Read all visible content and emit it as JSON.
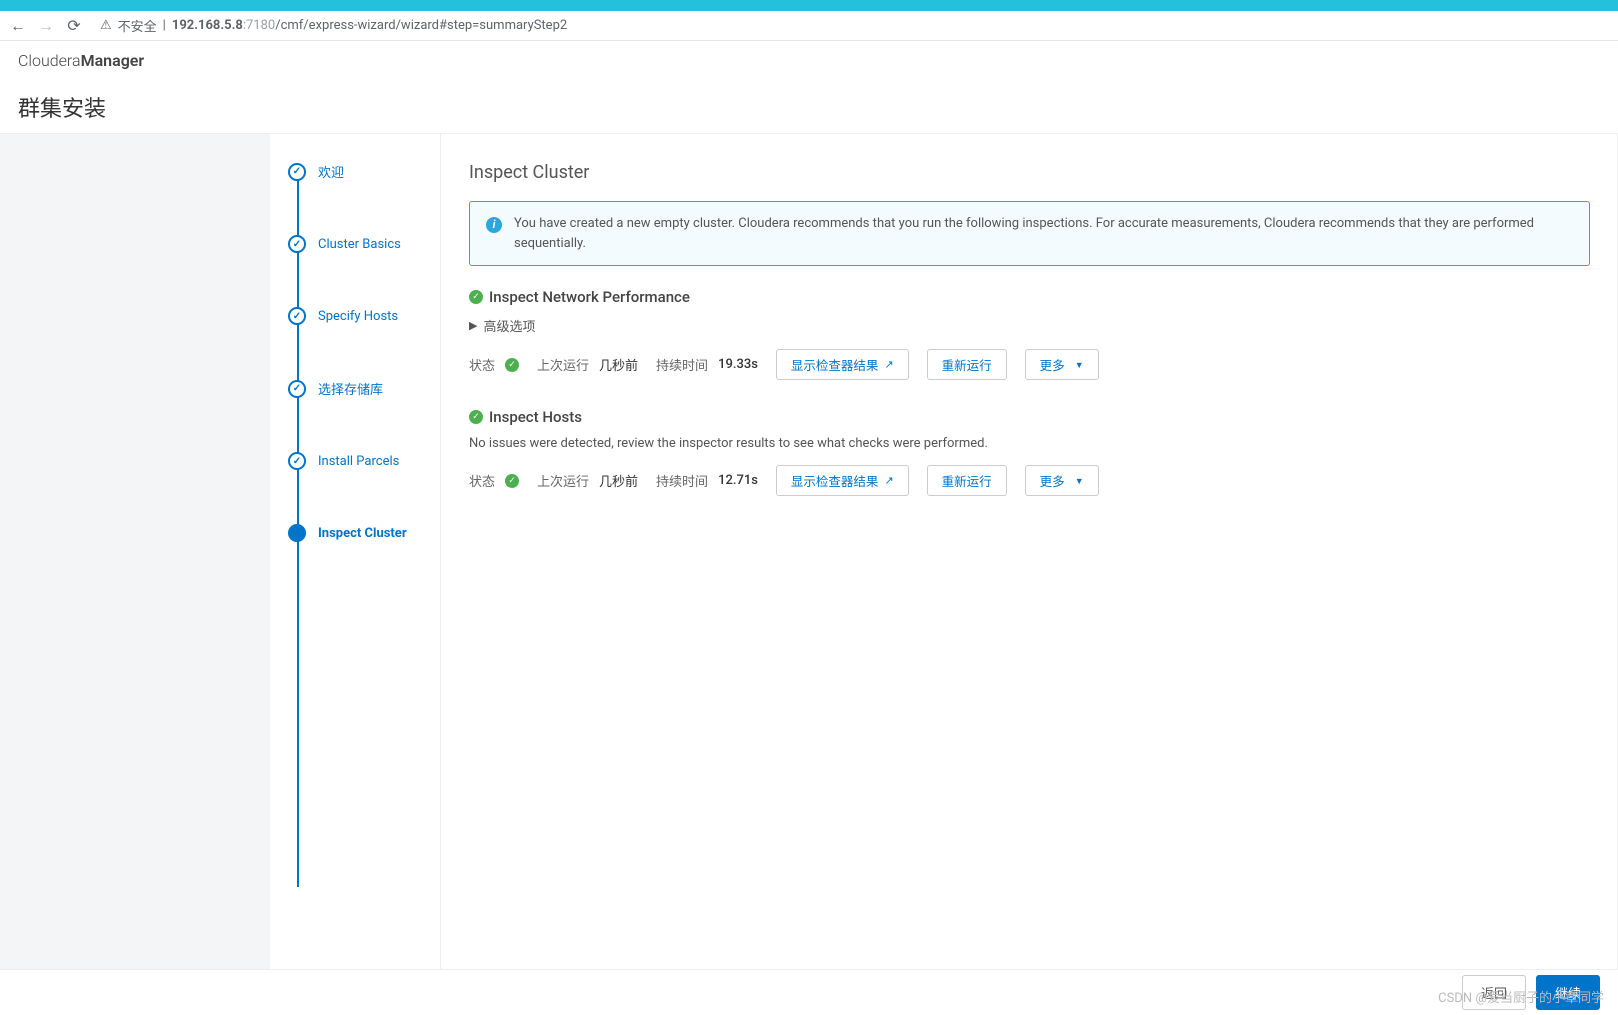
{
  "browser": {
    "insecure_label": "不安全",
    "url_host": "192.168.5.8",
    "url_port": ":7180",
    "url_path": "/cmf/express-wizard/wizard#step=summaryStep2"
  },
  "header": {
    "brand_light": "Cloudera ",
    "brand_bold": "Manager"
  },
  "page_title": "群集安装",
  "steps": [
    {
      "label": "欢迎",
      "completed": true,
      "current": false
    },
    {
      "label": "Cluster Basics",
      "completed": true,
      "current": false
    },
    {
      "label": "Specify Hosts",
      "completed": true,
      "current": false
    },
    {
      "label": "选择存储库",
      "completed": true,
      "current": false
    },
    {
      "label": "Install Parcels",
      "completed": true,
      "current": false
    },
    {
      "label": "Inspect Cluster",
      "completed": false,
      "current": true
    }
  ],
  "content": {
    "title": "Inspect Cluster",
    "info": "You have created a new empty cluster. Cloudera recommends that you run the following inspections. For accurate measurements, Cloudera recommends that they are performed sequentially.",
    "network": {
      "title": "Inspect Network Performance",
      "advanced": "高级选项",
      "status_label": "状态",
      "lastrun_label": "上次运行",
      "lastrun_value": "几秒前",
      "duration_label": "持续时间",
      "duration_value": "19.33s",
      "show_results": "显示检查器结果",
      "rerun": "重新运行",
      "more": "更多"
    },
    "hosts": {
      "title": "Inspect Hosts",
      "desc": "No issues were detected, review the inspector results to see what checks were performed.",
      "status_label": "状态",
      "lastrun_label": "上次运行",
      "lastrun_value": "几秒前",
      "duration_label": "持续时间",
      "duration_value": "12.71s",
      "show_results": "显示检查器结果",
      "rerun": "重新运行",
      "more": "更多"
    }
  },
  "footer": {
    "back": "返回",
    "continue": "继续"
  },
  "watermark": "CSDN @爱当厨子的小章同学"
}
